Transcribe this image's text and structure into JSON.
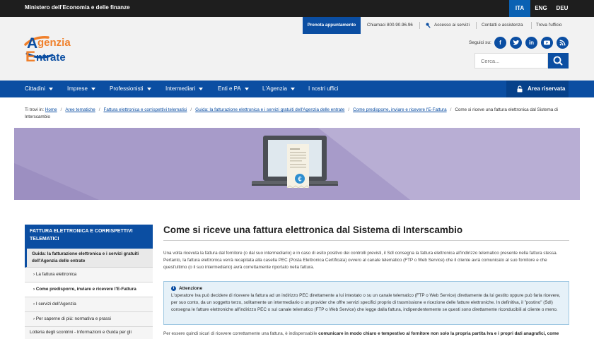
{
  "topbar": {
    "ministry": "Ministero dell'Economia e delle finanze",
    "languages": [
      {
        "label": "ITA",
        "active": true
      },
      {
        "label": "ENG",
        "active": false
      },
      {
        "label": "DEU",
        "active": false
      }
    ]
  },
  "utility": {
    "book": "Prenota appuntamento",
    "call": "Chiamaci 800.90.96.96",
    "access": "Accesso ai servizi",
    "contacts": "Contatti e assistenza",
    "office": "Trova l'ufficio"
  },
  "brand": {
    "line1": "genzia",
    "line2": "ntrate",
    "initial1": "A",
    "initial2": "E",
    "colors": {
      "blue": "#0b4ea2",
      "orange": "#f0802b"
    }
  },
  "social": {
    "label": "Seguici su:",
    "icons": [
      "facebook-icon",
      "twitter-icon",
      "linkedin-icon",
      "youtube-icon",
      "rss-icon"
    ]
  },
  "search": {
    "placeholder": "Cerca..."
  },
  "nav": {
    "items": [
      {
        "label": "Cittadini",
        "caret": true
      },
      {
        "label": "Imprese",
        "caret": true
      },
      {
        "label": "Professionisti",
        "caret": true
      },
      {
        "label": "Intermediari",
        "caret": true
      },
      {
        "label": "Enti e PA",
        "caret": true
      },
      {
        "label": "L'Agenzia",
        "caret": true
      },
      {
        "label": "I nostri uffici",
        "caret": false
      }
    ],
    "reserved": "Area riservata"
  },
  "breadcrumb": {
    "prefix": "Ti trovi in:",
    "links": [
      "Home",
      "Aree tematiche",
      "Fattura elettronica e corrispettivi telematici",
      "Guida: la fatturazione elettronica e i servizi gratuiti dell'Agenzia delle entrate",
      "Come predisporre, inviare e ricevere l'E-Fattura"
    ],
    "current": "Come si riceve una fattura elettronica dal Sistema di Interscambio"
  },
  "sidebar": {
    "heading": "FATTURA ELETTRONICA E CORRISPETTIVI TELEMATICI",
    "section": "Guida: la fatturazione elettronica e i servizi gratuiti dell'Agenzia delle entrate",
    "items": [
      {
        "label": "La fattura elettronica",
        "active": false
      },
      {
        "label": "Come predisporre, inviare e ricevere l'E-Fattura",
        "active": true
      },
      {
        "label": "I servizi dell'Agenzia",
        "active": false
      },
      {
        "label": "Per saperne di più: normativa e prassi",
        "active": false
      }
    ],
    "next": "Lotteria degli scontrini - Informazioni e Guida per gli"
  },
  "main": {
    "title": "Come si riceve una fattura elettronica dal Sistema di Interscambio",
    "para1": "Una volta ricevuta la fattura dal fornitore (o dal suo intermediario) e in caso di esito positivo dei controlli previsti, il SdI consegna la fattura elettronica all'indirizzo telematico presente nella fattura stessa. Pertanto, la fattura elettronica verrà recapitata alla casella PEC (Posta Elettronica Certificata) ovvero al canale telematico (FTP o Web Service) che il cliente avrà comunicato al suo fornitore e che quest'ultimo (o il suo intermediario) avrà correttamente riportato nella fattura.",
    "notice_title": "Attenzione",
    "notice_text": "L'operatore Iva può decidere di ricevere la fattura ad un indirizzo PEC direttamente a lui intestato o su un canale telematico (FTP o Web Service) direttamente da lui gestito oppure può farla ricevere, per suo conto, da un soggetto terzo, solitamente un intermediario o un provider che offre servizi specifici proprio di trasmissione e ricezione delle fatture elettroniche. In definitiva, il \"postino\" (SdI) consegna le fatture elettroniche all'indirizzo PEC o sul canale telematico (FTP o Web Service) che legge dalla fattura, indipendentemente se questi sono direttamente riconducibili al cliente o meno.",
    "para2_start": "Per essere quindi sicuri di ricevere correttamente una fattura, è indispensabile ",
    "para2_bold": "comunicare in modo chiaro e tempestivo al fornitore non solo la propria partita Iva e i propri dati anagrafici, come"
  },
  "banner": {
    "currency_symbol": "€"
  }
}
